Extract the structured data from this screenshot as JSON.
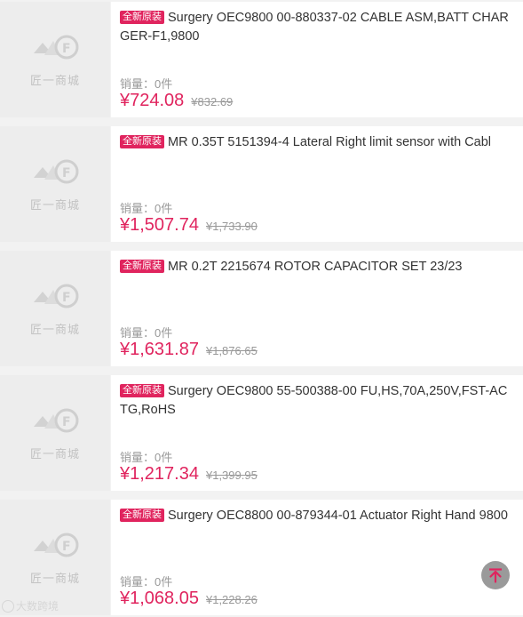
{
  "colors": {
    "accent": "#e0245e",
    "tag_bg": "#e0245e",
    "muted": "#999999",
    "placeholder_bg": "#ededed"
  },
  "placeholder": {
    "brand": "匠一商城",
    "icon": "jiangyi-logo-icon"
  },
  "products": [
    {
      "tag": "全新原装",
      "title": "Surgery OEC9800 00-880337-02 CABLE ASM,BATT CHARGER-F1,9800",
      "sales": "销量：0件",
      "price": "¥724.08",
      "original_price": "¥832.69"
    },
    {
      "tag": "全新原装",
      "title": "MR 0.35T 5151394-4 Lateral Right limit sensor with Cabl",
      "sales": "销量：0件",
      "price": "¥1,507.74",
      "original_price": "¥1,733.90"
    },
    {
      "tag": "全新原装",
      "title": "MR 0.2T 2215674 ROTOR CAPACITOR SET 23/23",
      "sales": "销量：0件",
      "price": "¥1,631.87",
      "original_price": "¥1,876.65"
    },
    {
      "tag": "全新原装",
      "title": "Surgery OEC9800 55-500388-00 FU,HS,70A,250V,FST-ACTG,RoHS",
      "sales": "销量：0件",
      "price": "¥1,217.34",
      "original_price": "¥1,399.95"
    },
    {
      "tag": "全新原装",
      "title": "Surgery OEC8800 00-879344-01 Actuator Right Hand 9800",
      "sales": "销量：0件",
      "price": "¥1,068.05",
      "original_price": "¥1,228.26"
    }
  ],
  "back_to_top": {
    "icon": "arrow-up-to-top-icon"
  },
  "watermark": {
    "text": "大数跨境",
    "icon": "watermark-logo-icon"
  }
}
